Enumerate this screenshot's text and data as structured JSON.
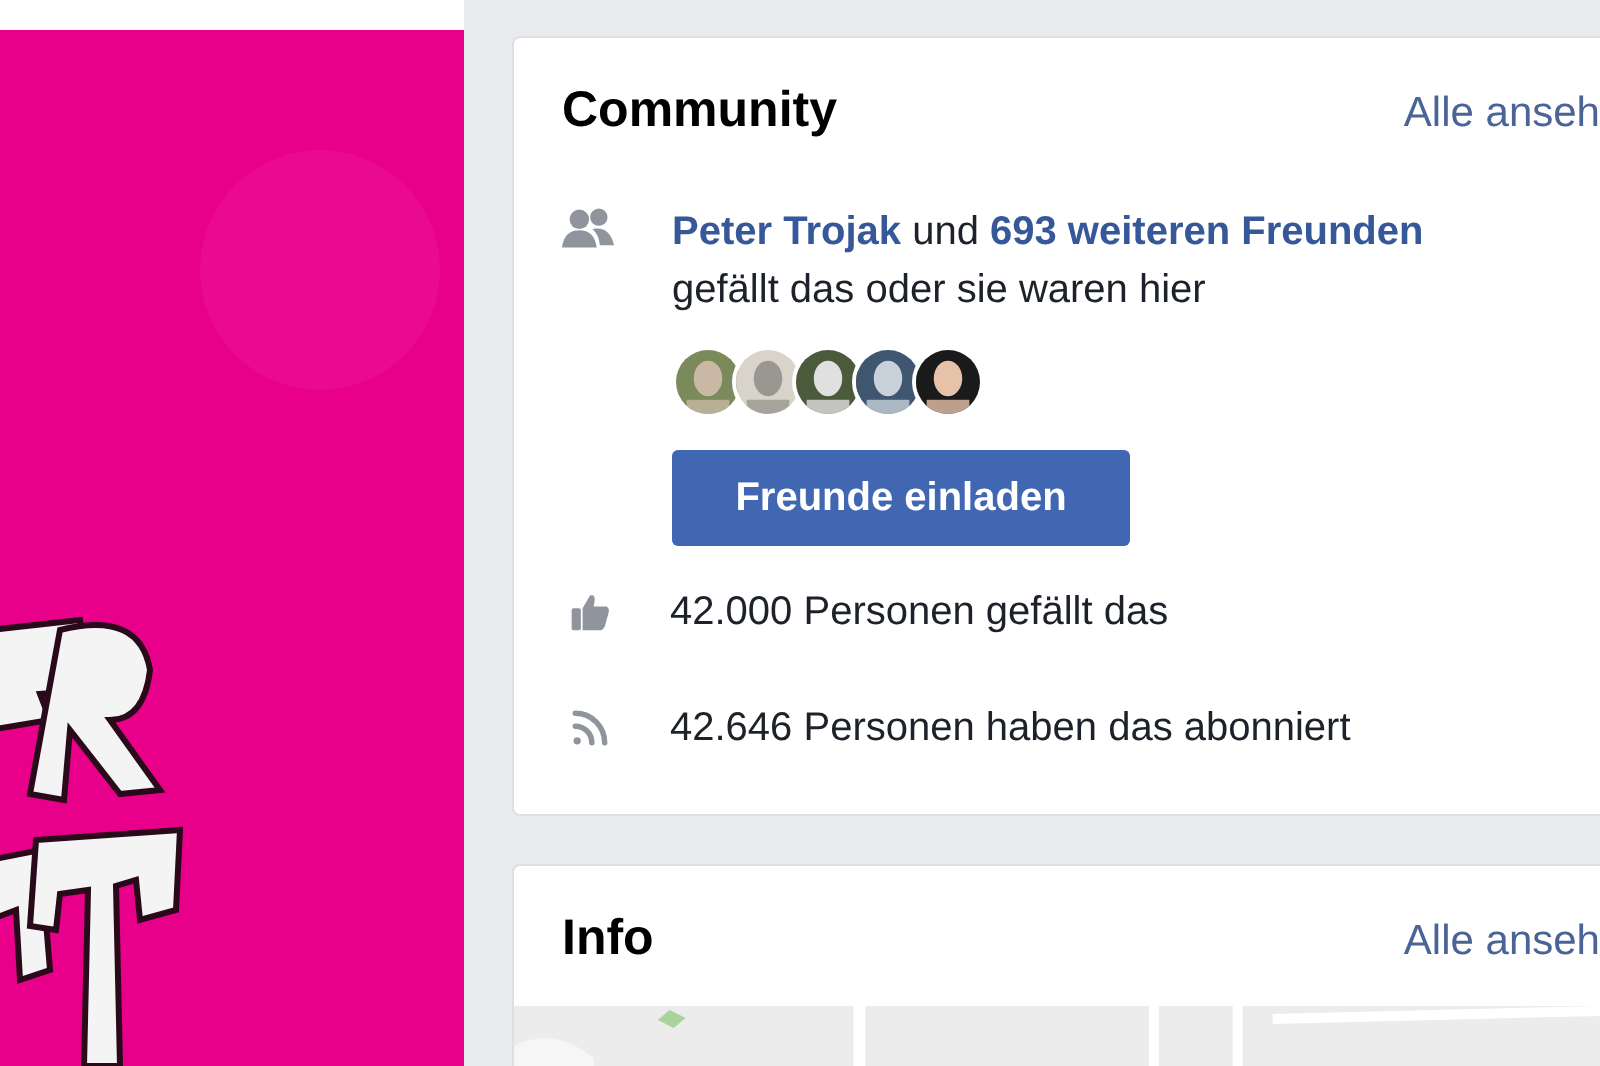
{
  "community": {
    "title": "Community",
    "see_all": "Alle anseh",
    "friends": {
      "text": "**Peter Trojak** und **693 weiteren Freunden**",
      "subtext": "gefällt das oder sie waren hier"
    },
    "invite_button": "Freunde einladen",
    "stats": [
      {
        "kind": "likes",
        "text": "42.000 Personen gefällt das"
      },
      {
        "kind": "follows",
        "text": "42.646 Personen haben das abonniert"
      }
    ]
  },
  "info": {
    "title": "Info",
    "see_all": "Alle anseh"
  }
}
